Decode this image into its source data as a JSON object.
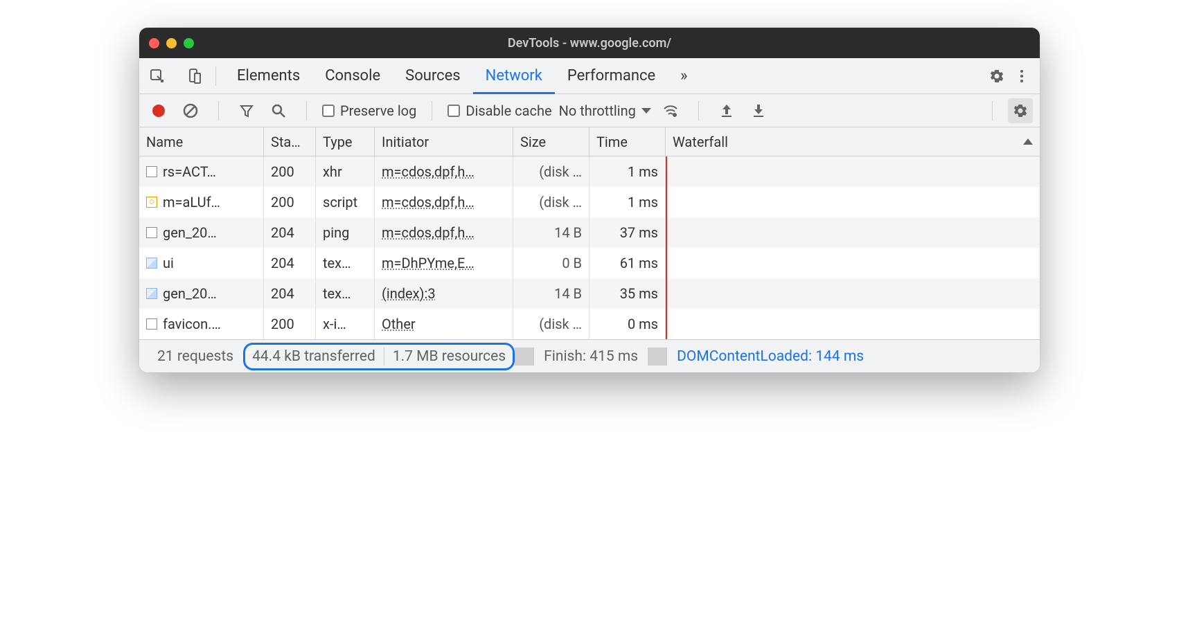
{
  "window": {
    "title": "DevTools - www.google.com/"
  },
  "tabs": {
    "items": [
      "Elements",
      "Console",
      "Sources",
      "Network",
      "Performance"
    ],
    "active": "Network",
    "overflow": "»"
  },
  "toolbar": {
    "preserve_log": "Preserve log",
    "disable_cache": "Disable cache",
    "throttling": "No throttling"
  },
  "columns": {
    "name": "Name",
    "status": "Sta…",
    "type": "Type",
    "initiator": "Initiator",
    "size": "Size",
    "time": "Time",
    "waterfall": "Waterfall"
  },
  "rows": [
    {
      "icon": "doc",
      "name": "rs=ACT…",
      "status": "200",
      "type": "xhr",
      "initiator": "m=cdos,dpf,h…",
      "size": "(disk …",
      "time": "1 ms",
      "bars": [
        {
          "l": 61,
          "w": 3,
          "c": "#4fc3f7"
        }
      ]
    },
    {
      "icon": "script",
      "name": "m=aLUf…",
      "status": "200",
      "type": "script",
      "initiator": "m=cdos,dpf,h…",
      "size": "(disk …",
      "time": "1 ms",
      "bars": [
        {
          "l": 59,
          "w": 3,
          "c": "#4fc3f7"
        }
      ]
    },
    {
      "icon": "doc",
      "name": "gen_20…",
      "status": "204",
      "type": "ping",
      "initiator": "m=cdos,dpf,h…",
      "size": "14 B",
      "time": "37 ms",
      "bars": [
        {
          "l": 75,
          "w": 12,
          "c": "#34a853"
        },
        {
          "l": 87,
          "w": 2,
          "c": "#4fc3f7"
        }
      ]
    },
    {
      "icon": "image",
      "name": "ui",
      "status": "204",
      "type": "tex…",
      "initiator": "m=DhPYme,E…",
      "size": "0 B",
      "time": "61 ms",
      "bars": [
        {
          "l": 78,
          "w": 4,
          "c": "#00897b"
        },
        {
          "l": 82,
          "w": 5,
          "c": "#b300b3"
        },
        {
          "l": 87,
          "w": 10,
          "c": "#34a853"
        },
        {
          "l": 97,
          "w": 2,
          "c": "#4fc3f7"
        }
      ]
    },
    {
      "icon": "image",
      "name": "gen_20…",
      "status": "204",
      "type": "tex…",
      "initiator": "(index):3",
      "size": "14 B",
      "time": "35 ms",
      "bars": [
        {
          "l": 75,
          "w": 12,
          "c": "#34a853"
        },
        {
          "l": 87,
          "w": 2,
          "c": "#4fc3f7"
        }
      ]
    },
    {
      "icon": "doc",
      "name": "favicon.…",
      "status": "200",
      "type": "x-i…",
      "initiator": "Other",
      "size": "(disk …",
      "time": "0 ms",
      "bars": [
        {
          "l": 75,
          "w": 2,
          "c": "#4fc3f7"
        }
      ]
    }
  ],
  "waterfall_lines": {
    "blue": 22,
    "red": 67
  },
  "status": {
    "requests": "21 requests",
    "transferred": "44.4 kB transferred",
    "resources": "1.7 MB resources",
    "finish": "Finish: 415 ms",
    "dcl": "DOMContentLoaded: 144 ms"
  }
}
